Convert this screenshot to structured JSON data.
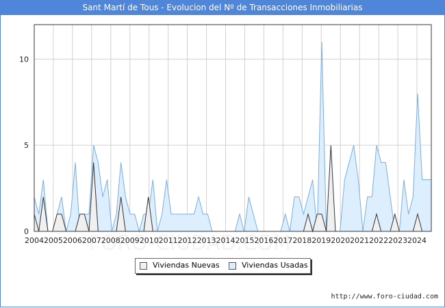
{
  "title": "Sant Martí de Tous - Evolucion del Nº de Transacciones Inmobiliarias",
  "footer": "http://www.foro-ciudad.com",
  "watermark": "FORO-CIUDAD.COM",
  "colors": {
    "title_bg": "#4f86d9",
    "nuevas_fill": "#f0f0f0",
    "usadas_fill": "#ddeeff",
    "usadas_line": "#7aaee0"
  },
  "legend": {
    "nuevas": "Viviendas Nuevas",
    "usadas": "Viviendas Usadas"
  },
  "chart_data": {
    "type": "area",
    "x_start": 2004,
    "x_end": 2024.75,
    "ylim": [
      0,
      12
    ],
    "yticks": [
      0,
      5,
      10
    ],
    "xticks": [
      "2004",
      "2005",
      "2006",
      "2007",
      "2008",
      "2009",
      "2010",
      "2011",
      "2012",
      "2013",
      "2014",
      "2015",
      "2016",
      "2017",
      "2018",
      "2019",
      "2020",
      "2021",
      "2022",
      "2023",
      "2024"
    ],
    "grid": true,
    "legend_position": "bottom",
    "series": [
      {
        "name": "Viviendas Usadas",
        "values": [
          2,
          1,
          3,
          0,
          0,
          1,
          2,
          0,
          1,
          4,
          0,
          1,
          1,
          5,
          4,
          2,
          3,
          0,
          1,
          4,
          2,
          1,
          1,
          0,
          1,
          1,
          3,
          0,
          1,
          3,
          1,
          1,
          1,
          1,
          1,
          1,
          2,
          1,
          1,
          0,
          0,
          0,
          0,
          0,
          0,
          1,
          0,
          2,
          1,
          0,
          0,
          0,
          0,
          0,
          0,
          1,
          0,
          2,
          2,
          1,
          2,
          3,
          0,
          11,
          0,
          2,
          0,
          0,
          3,
          4,
          5,
          3,
          0,
          2,
          2,
          5,
          4,
          4,
          2,
          0,
          0,
          3,
          1,
          2,
          8,
          3,
          3,
          3
        ]
      },
      {
        "name": "Viviendas Nuevas",
        "values": [
          1,
          0,
          2,
          0,
          0,
          1,
          1,
          0,
          0,
          0,
          1,
          1,
          0,
          4,
          0,
          0,
          0,
          0,
          0,
          2,
          0,
          0,
          0,
          0,
          0,
          2,
          0,
          0,
          0,
          0,
          0,
          0,
          0,
          0,
          0,
          0,
          0,
          0,
          0,
          0,
          0,
          0,
          0,
          0,
          0,
          0,
          0,
          0,
          0,
          0,
          0,
          0,
          0,
          0,
          0,
          0,
          0,
          0,
          0,
          0,
          1,
          0,
          1,
          1,
          0,
          5,
          0,
          0,
          0,
          0,
          0,
          0,
          0,
          0,
          0,
          1,
          0,
          0,
          0,
          1,
          0,
          0,
          0,
          0,
          1,
          0,
          0,
          0
        ]
      }
    ]
  }
}
